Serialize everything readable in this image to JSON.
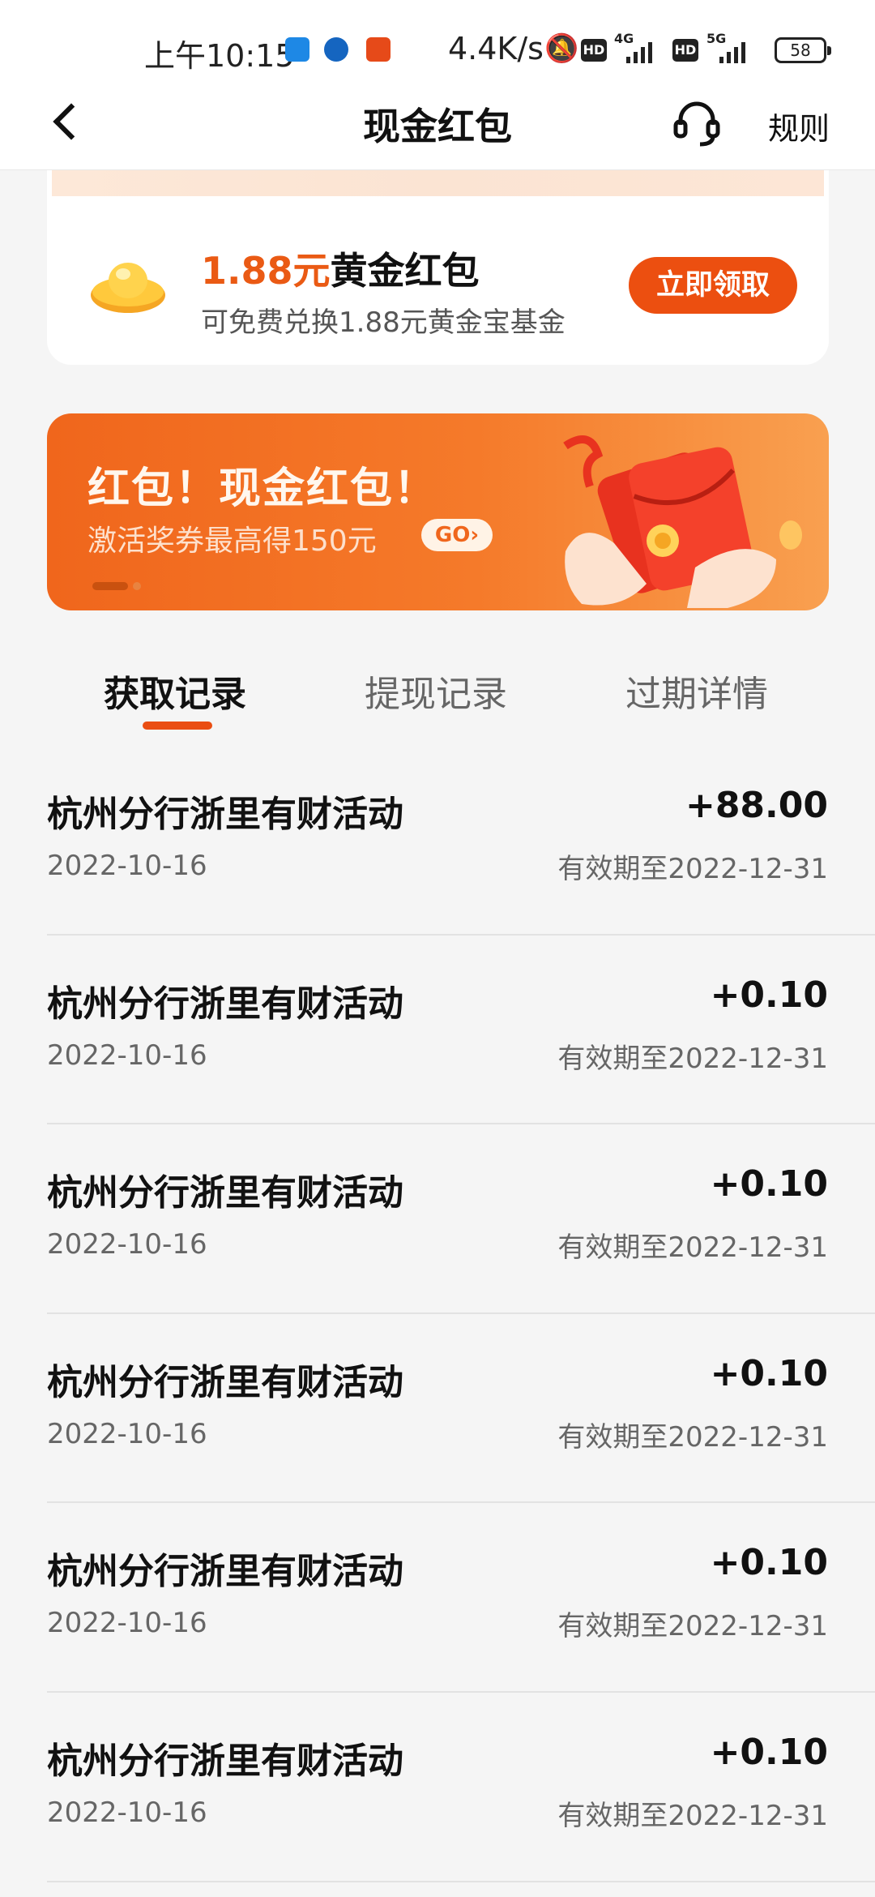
{
  "status_bar": {
    "time": "上午10:15",
    "net_speed": "4.4K/s",
    "hd1": "HD",
    "net1": "4G",
    "hd2": "HD",
    "net2": "5G",
    "battery": "58"
  },
  "nav": {
    "title": "现金红包",
    "rules": "规则"
  },
  "gold_card": {
    "amount": "1.88元",
    "title_rest": "黄金红包",
    "subtitle": "可免费兑换1.88元黄金宝基金",
    "claim_button": "立即领取"
  },
  "banner": {
    "title": "红包！现金红包！",
    "subtitle": "激活奖券最高得150元",
    "go_label": "GO›"
  },
  "tabs": [
    {
      "label": "获取记录",
      "active": true
    },
    {
      "label": "提现记录",
      "active": false
    },
    {
      "label": "过期详情",
      "active": false
    }
  ],
  "records": [
    {
      "title": "杭州分行浙里有财活动",
      "date": "2022-10-16",
      "amount": "+88.00",
      "expiry": "有效期至2022-12-31"
    },
    {
      "title": "杭州分行浙里有财活动",
      "date": "2022-10-16",
      "amount": "+0.10",
      "expiry": "有效期至2022-12-31"
    },
    {
      "title": "杭州分行浙里有财活动",
      "date": "2022-10-16",
      "amount": "+0.10",
      "expiry": "有效期至2022-12-31"
    },
    {
      "title": "杭州分行浙里有财活动",
      "date": "2022-10-16",
      "amount": "+0.10",
      "expiry": "有效期至2022-12-31"
    },
    {
      "title": "杭州分行浙里有财活动",
      "date": "2022-10-16",
      "amount": "+0.10",
      "expiry": "有效期至2022-12-31"
    },
    {
      "title": "杭州分行浙里有财活动",
      "date": "2022-10-16",
      "amount": "+0.10",
      "expiry": "有效期至2022-12-31"
    }
  ],
  "colors": {
    "accent": "#ea5a14",
    "button": "#ec4f10",
    "background": "#f5f5f5"
  }
}
